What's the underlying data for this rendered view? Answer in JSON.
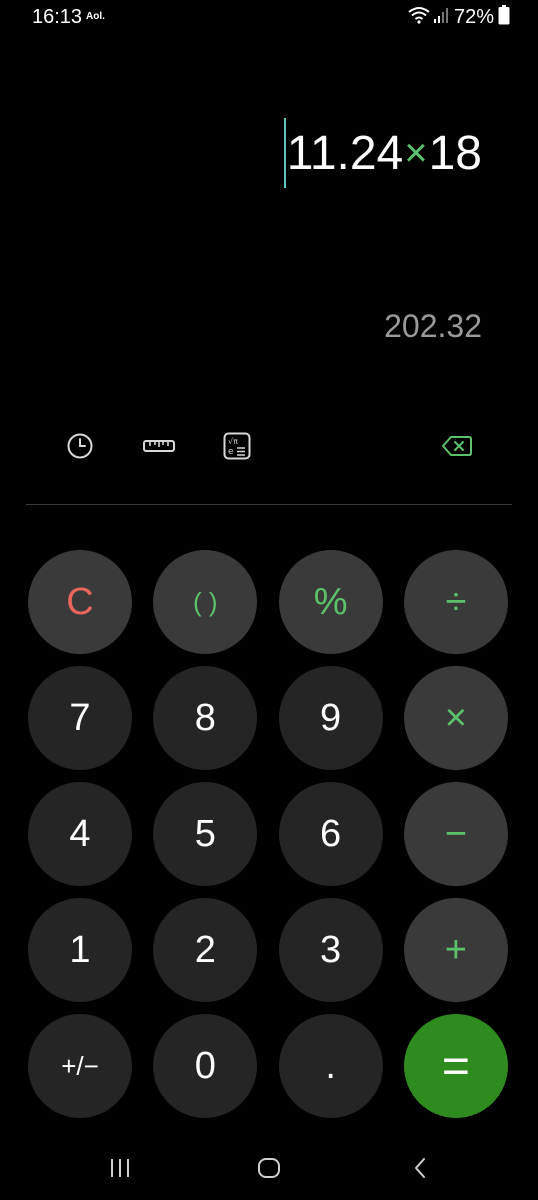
{
  "status_bar": {
    "time": "16:13",
    "carrier": "Aol.",
    "battery": "72%",
    "icons": [
      "wifi-icon",
      "signal-icon",
      "battery-icon"
    ]
  },
  "display": {
    "expression_operand_1": "11.24",
    "expression_operator": "×",
    "expression_operand_2": "18",
    "result": "202.32"
  },
  "tools": {
    "history": "history-icon",
    "converter": "ruler-icon",
    "scientific": "scientific-icon",
    "backspace": "backspace-icon"
  },
  "keys": {
    "clear": "C",
    "parentheses": "( )",
    "percent": "%",
    "divide": "÷",
    "seven": "7",
    "eight": "8",
    "nine": "9",
    "multiply": "×",
    "four": "4",
    "five": "5",
    "six": "6",
    "minus": "−",
    "one": "1",
    "two": "2",
    "three": "3",
    "plus": "+",
    "negate": "+/−",
    "zero": "0",
    "decimal": ".",
    "equals": "="
  },
  "nav": {
    "recents": "recents-icon",
    "home": "home-icon",
    "back": "back-icon"
  },
  "colors": {
    "background": "#000000",
    "key_number": "#252525",
    "key_function": "#3a3a3a",
    "accent_green": "#5cc26a",
    "equals_green": "#2e8b1e",
    "clear_red": "#e8665b",
    "cursor": "#5fc7c0",
    "result_gray": "#9a9a9a"
  }
}
